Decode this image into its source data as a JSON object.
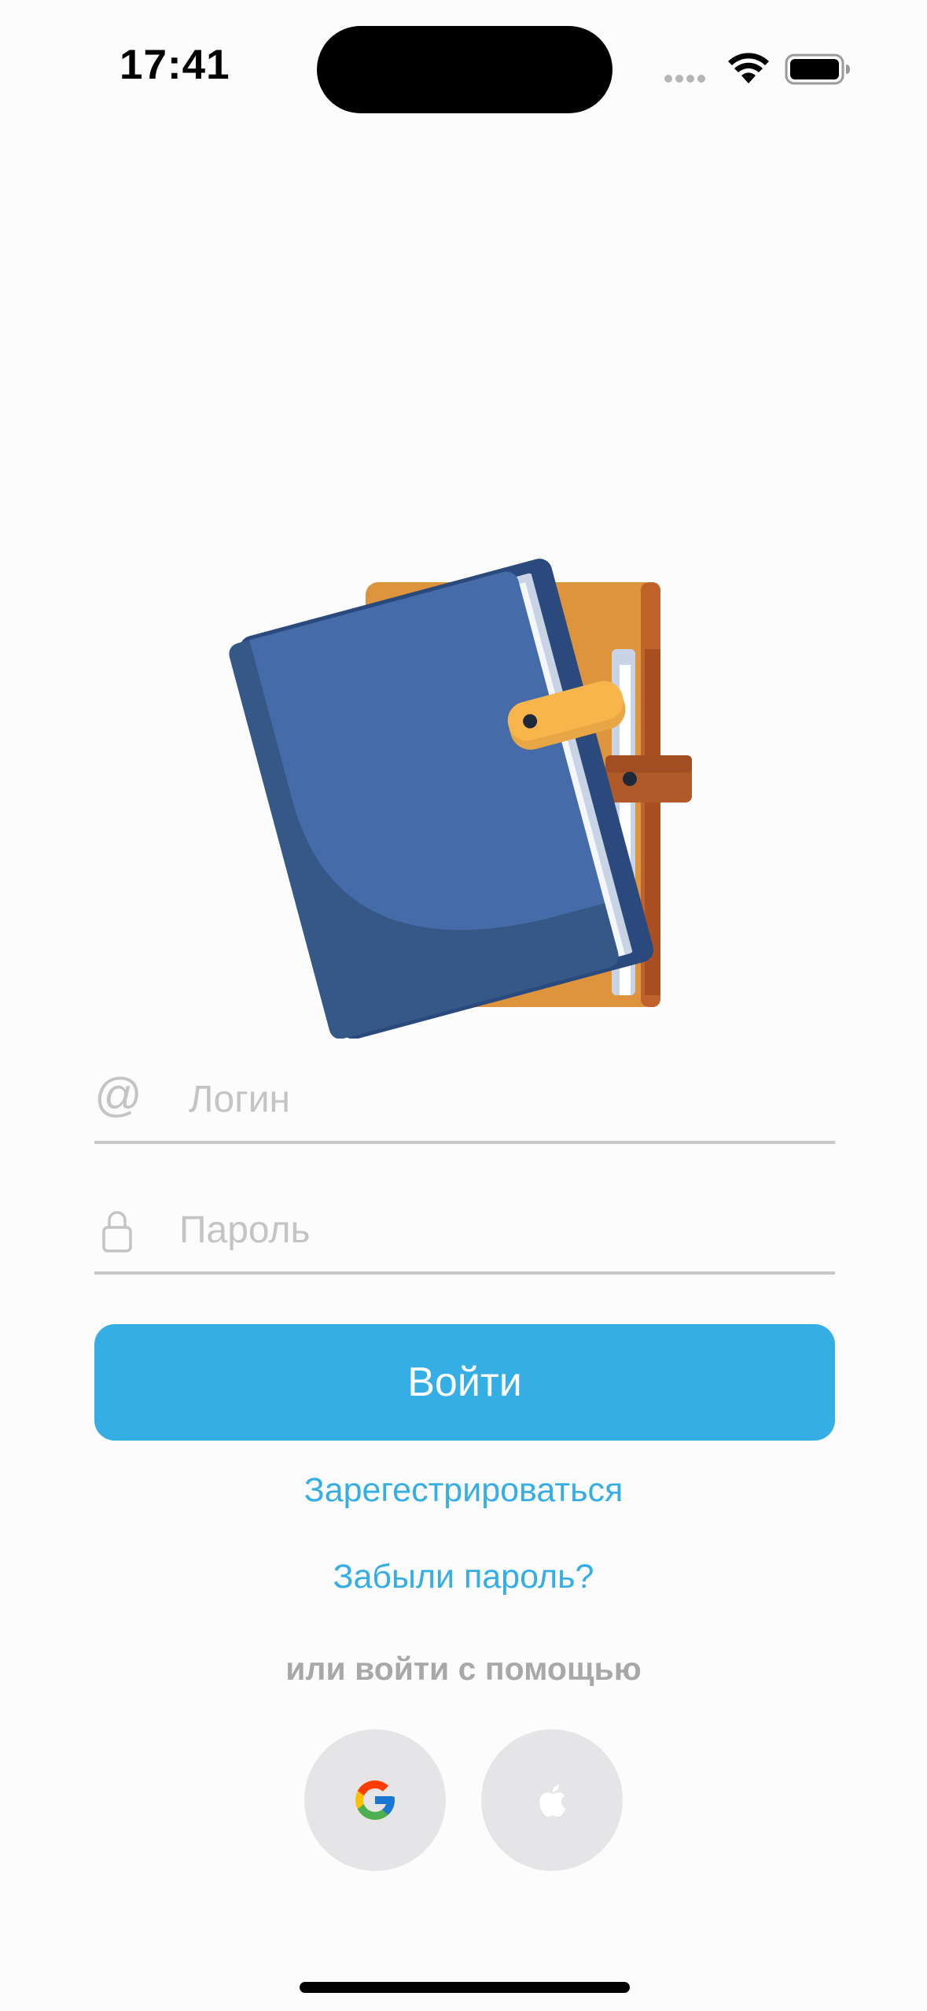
{
  "status_bar": {
    "time": "17:41"
  },
  "login_form": {
    "login_placeholder": "Логин",
    "login_value": "",
    "password_placeholder": "Пароль",
    "password_value": "",
    "submit_label": "Войти",
    "register_label": "Зарегестрироваться",
    "forgot_label": "Забыли пароль?",
    "alt_login_text": "или войти с помощью",
    "at_symbol": "@"
  },
  "social_buttons": [
    {
      "icon": "google-icon"
    },
    {
      "icon": "apple-icon"
    }
  ],
  "colors": {
    "accent": "#35aee6",
    "placeholder": "#c4c4c6",
    "social_bg": "#e5e5e7"
  }
}
